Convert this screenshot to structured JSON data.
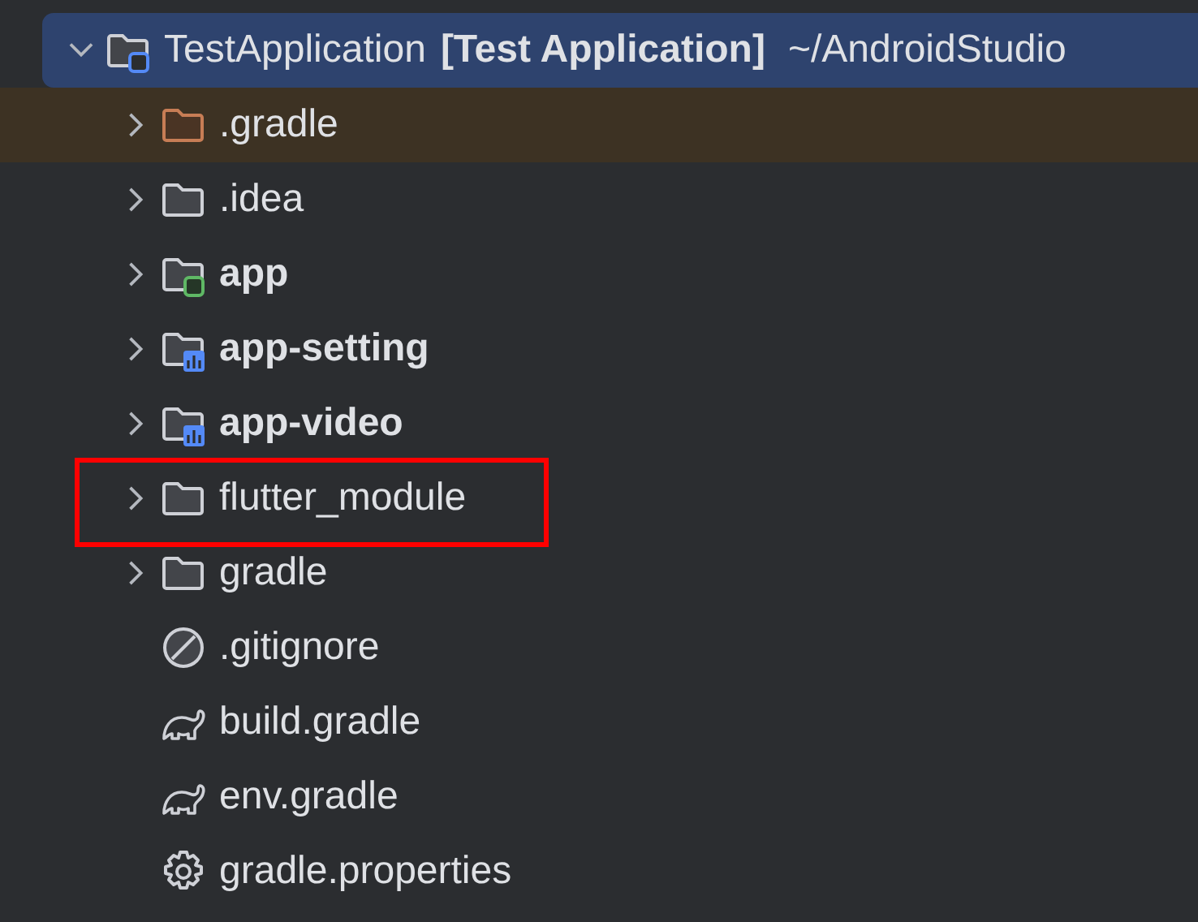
{
  "tree": [
    {
      "name": "TestApplication",
      "module_label": "[Test Application]",
      "path": "~/AndroidStudio",
      "kind": "root-module",
      "expanded": true,
      "selected": true,
      "bold": false,
      "highlighted": false,
      "children": [
        {
          "name": ".gradle",
          "kind": "excluded-folder",
          "expanded": false,
          "selected": false,
          "bold": false,
          "highlighted": false
        },
        {
          "name": ".idea",
          "kind": "folder",
          "expanded": false,
          "selected": false,
          "bold": false,
          "highlighted": false
        },
        {
          "name": "app",
          "kind": "app-module",
          "expanded": false,
          "selected": false,
          "bold": true,
          "highlighted": false
        },
        {
          "name": "app-setting",
          "kind": "library-module",
          "expanded": false,
          "selected": false,
          "bold": true,
          "highlighted": false
        },
        {
          "name": "app-video",
          "kind": "library-module",
          "expanded": false,
          "selected": false,
          "bold": true,
          "highlighted": false
        },
        {
          "name": "flutter_module",
          "kind": "folder",
          "expanded": false,
          "selected": false,
          "bold": false,
          "highlighted": true
        },
        {
          "name": "gradle",
          "kind": "folder",
          "expanded": false,
          "selected": false,
          "bold": false,
          "highlighted": false
        },
        {
          "name": ".gitignore",
          "kind": "ignore-file",
          "selected": false,
          "bold": false,
          "highlighted": false
        },
        {
          "name": "build.gradle",
          "kind": "gradle-file",
          "selected": false,
          "bold": false,
          "highlighted": false
        },
        {
          "name": "env.gradle",
          "kind": "gradle-file",
          "selected": false,
          "bold": false,
          "highlighted": false
        },
        {
          "name": "gradle.properties",
          "kind": "properties-file",
          "selected": false,
          "bold": false,
          "highlighted": false
        }
      ]
    }
  ]
}
